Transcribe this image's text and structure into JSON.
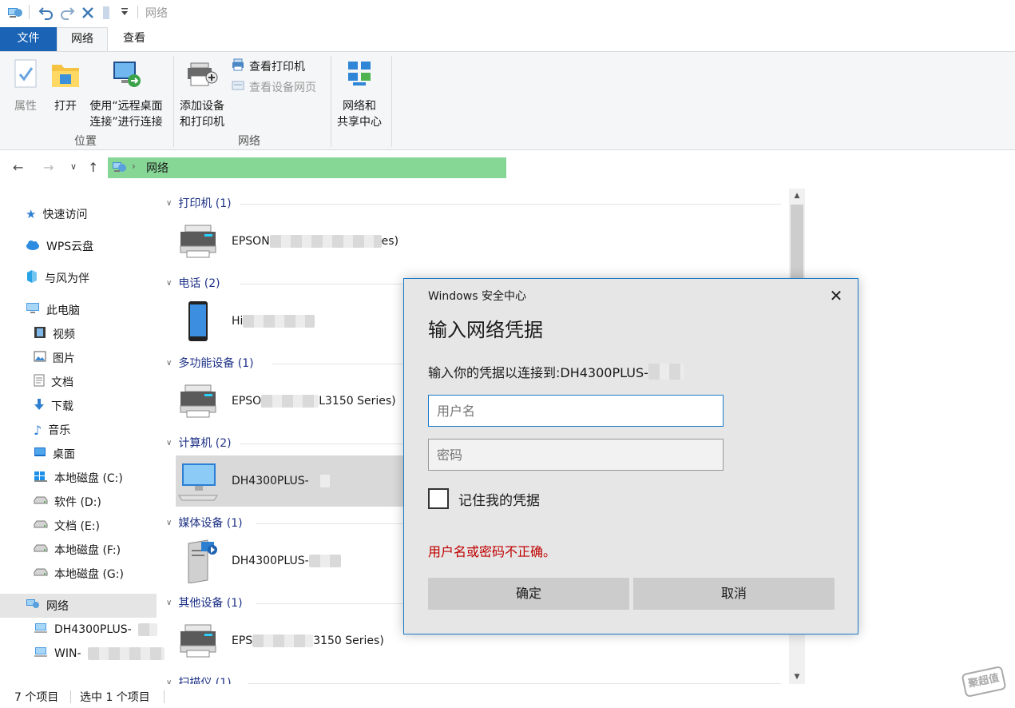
{
  "window": {
    "title": "网络"
  },
  "ribbon": {
    "tabs": {
      "file": "文件",
      "network": "网络",
      "view": "查看"
    },
    "location_group": {
      "label": "位置",
      "properties": "属性",
      "open": "打开",
      "remote_line1": "使用“远程桌面",
      "remote_line2": "连接”进行连接"
    },
    "network_group": {
      "label": "网络",
      "add_line1": "添加设备",
      "add_line2": "和打印机",
      "view_printers": "查看打印机",
      "view_device_page": "查看设备网页"
    },
    "sharing": {
      "line1": "网络和",
      "line2": "共享中心"
    }
  },
  "address": {
    "crumb": "网络"
  },
  "nav": {
    "quick_access": "快速访问",
    "wps": "WPS云盘",
    "yufeng": "与风为伴",
    "this_pc": "此电脑",
    "videos": "视频",
    "pictures": "图片",
    "documents": "文档",
    "downloads": "下载",
    "music": "音乐",
    "desktop": "桌面",
    "drive_c": "本地磁盘 (C:)",
    "drive_d": "软件 (D:)",
    "drive_e": "文档 (E:)",
    "drive_f": "本地磁盘 (F:)",
    "drive_g": "本地磁盘 (G:)",
    "network": "网络",
    "net_pc1": "DH4300PLUS-",
    "net_pc2": "WIN-"
  },
  "content": {
    "groups": {
      "printers": "打印机 (1)",
      "phones": "电话 (2)",
      "multifunction": "多功能设备 (1)",
      "computers": "计算机 (2)",
      "media": "媒体设备 (1)",
      "other": "其他设备 (1)",
      "scanners": "扫描仪 (1)"
    },
    "items": {
      "printer_pre": "EPSON",
      "printer_suf": "es)",
      "phone_pre": "Hi",
      "mfp_pre": "EPSO",
      "mfp_suf": "L3150 Series)",
      "computer_pre": "DH4300PLUS-",
      "media_pre": "DH4300PLUS-",
      "other_pre": "EPS",
      "other_suf": "3150 Series)"
    }
  },
  "status": {
    "count": "7 个项目",
    "selected": "选中 1 个项目"
  },
  "dialog": {
    "title": "Windows 安全中心",
    "heading": "输入网络凭据",
    "subtitle": "输入你的凭据以连接到:DH4300PLUS-",
    "username_placeholder": "用户名",
    "password_placeholder": "密码",
    "remember": "记住我的凭据",
    "error": "用户名或密码不正确。",
    "ok": "确定",
    "cancel": "取消"
  },
  "watermark": "聚超值",
  "colors": {
    "accent": "#1979ca",
    "file_tab": "#1a63b5",
    "address_bg": "#86d695",
    "error": "#c00000",
    "group_header": "#1e3287"
  }
}
